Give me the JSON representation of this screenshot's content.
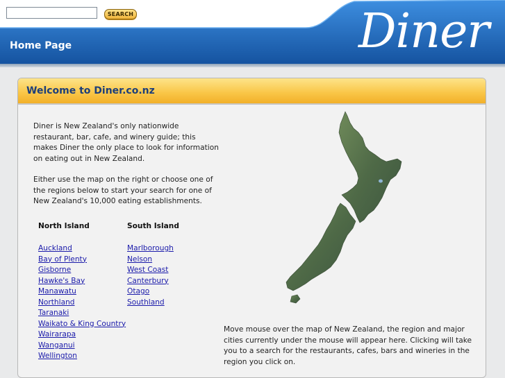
{
  "search": {
    "placeholder": "",
    "button_label": "SEARCH"
  },
  "header": {
    "home_title": "Home Page",
    "logo_text": "Diner"
  },
  "panel": {
    "title": "Welcome to Diner.co.nz",
    "intro": "Diner is New Zealand's only nationwide restaurant, bar, cafe, and winery guide; this makes Diner the only place to look for information on eating out in New Zealand.",
    "intro2": "Either use the map on the right or choose one of the regions below to start your search for one of New Zealand's 10,000 eating establishments.",
    "north_island": {
      "heading": "North Island",
      "regions": [
        "Auckland",
        "Bay of Plenty",
        "Gisborne",
        "Hawke's Bay",
        "Manawatu",
        "Northland",
        "Taranaki",
        "Waikato & King Country",
        "Wairarapa",
        "Wanganui",
        "Wellington"
      ]
    },
    "south_island": {
      "heading": "South Island",
      "regions": [
        "Marlborough",
        "Nelson",
        "West Coast",
        "Canterbury",
        "Otago",
        "Southland"
      ]
    },
    "map_note": "Move mouse over the map of New Zealand, the region and major cities currently under the mouse will appear here. Clicking will take you to a search for the restaurants, cafes, bars and wineries in the region you click on."
  },
  "colors": {
    "header_blue": "#1a5aa8",
    "panel_header_gold": "#f9c545",
    "title_navy": "#1d3f7a",
    "link_blue": "#1a1aaa"
  }
}
